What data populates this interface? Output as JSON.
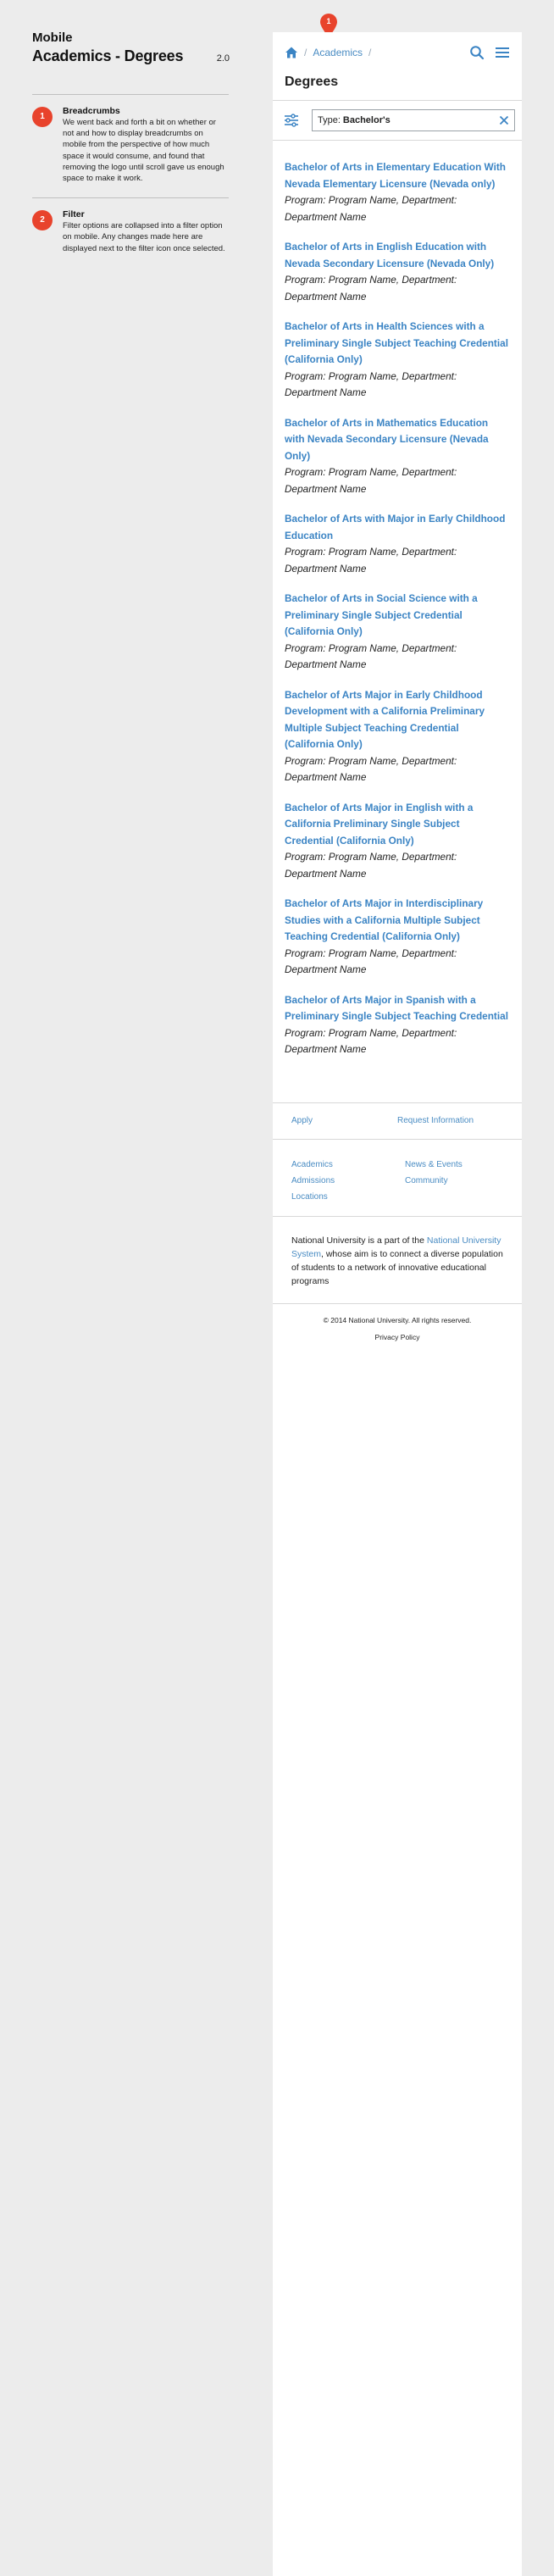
{
  "header": {
    "platform_label": "Mobile",
    "title": "Academics - Degrees",
    "version": "2.0"
  },
  "notes": [
    {
      "number": "1",
      "title": "Breadcrumbs",
      "text": "We went back and forth a bit on whether or not and how to display breadcrumbs on mobile from the perspective of how much space it would consume, and found that removing the logo until scroll gave us enough space to make it work."
    },
    {
      "number": "2",
      "title": "Filter",
      "text": "Filter options are collapsed into a filter option on mobile. Any changes made here are displayed next to the filter icon once selected."
    }
  ],
  "pin": {
    "number": "1"
  },
  "breadcrumb": {
    "separator": "/",
    "items": [
      "Academics"
    ]
  },
  "section_title": "Degrees",
  "filter": {
    "prefix": "Type:",
    "value": "Bachelor's"
  },
  "degrees": [
    {
      "title": "Bachelor of Arts in Elementary Education With Nevada Elementary Licensure (Nevada only)",
      "meta": "Program: Program Name, Department: Department Name"
    },
    {
      "title": "Bachelor of Arts in English Education with Nevada Secondary Licensure (Nevada Only)",
      "meta": "Program: Program Name, Department: Department Name"
    },
    {
      "title": "Bachelor of Arts in Health Sciences with a Preliminary Single Subject Teaching Credential (California Only)",
      "meta": "Program: Program Name, Department: Department Name"
    },
    {
      "title": "Bachelor of Arts in Mathematics Education with Nevada Secondary Licensure (Nevada Only)",
      "meta": "Program: Program Name, Department: Department Name"
    },
    {
      "title": "Bachelor of Arts with Major in Early Childhood Education",
      "meta": "Program: Program Name, Department: Department Name"
    },
    {
      "title": "Bachelor of Arts in Social Science with a Preliminary Single Subject Credential (California Only)",
      "meta": "Program: Program Name, Department: Department Name"
    },
    {
      "title": "Bachelor of Arts Major in Early Childhood Development with a California Preliminary Multiple Subject Teaching Credential (California Only)",
      "meta": "Program: Program Name, Department: Department Name"
    },
    {
      "title": "Bachelor of Arts Major in English with a California Preliminary Single Subject Credential (California Only)",
      "meta": "Program: Program Name, Department: Department Name"
    },
    {
      "title": "Bachelor of Arts Major in Interdisciplinary Studies with a California Multiple Subject Teaching Credential (California Only)",
      "meta": "Program: Program Name, Department: Department Name"
    },
    {
      "title": "Bachelor of Arts Major in Spanish with a Preliminary Single Subject Teaching Credential",
      "meta": "Program: Program Name, Department: Department Name"
    }
  ],
  "footer": {
    "actions": [
      "Apply",
      "Request Information"
    ],
    "nav": [
      "Academics",
      "News & Events",
      "Admissions",
      "Community",
      "Locations"
    ],
    "about": {
      "before": "National University is a part of the ",
      "link": "National University System",
      "after": ", whose aim is to connect a diverse population of students to a network of innovative educational programs"
    },
    "copyright": "© 2014 National University. All rights reserved.",
    "privacy": "Privacy Policy"
  },
  "colors": {
    "accent": "#3b84c4",
    "badge": "#e8432c"
  },
  "icons": [
    "home-icon",
    "search-icon",
    "menu-icon",
    "filter-icon",
    "close-icon",
    "map-pin-icon"
  ]
}
